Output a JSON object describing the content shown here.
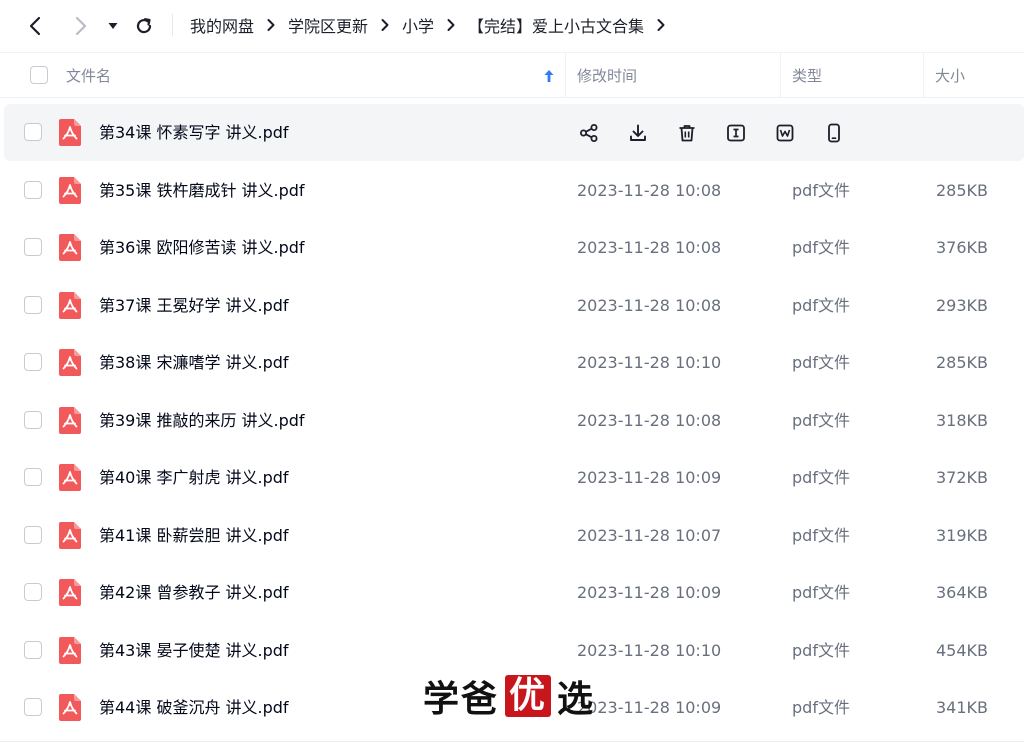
{
  "nav": {
    "back_icon": "chevron-left-icon",
    "forward_icon": "chevron-right-icon",
    "dropdown_icon": "caret-down-icon",
    "refresh_icon": "refresh-icon"
  },
  "breadcrumb": [
    {
      "label": "我的网盘"
    },
    {
      "label": "学院区更新"
    },
    {
      "label": "小学"
    },
    {
      "label": "【完结】爱上小古文合集"
    }
  ],
  "columns": {
    "name": "文件名",
    "time": "修改时间",
    "type": "类型",
    "size": "大小",
    "sort_icon": "sort-ascending-arrow-icon"
  },
  "hover_actions": [
    {
      "icon": "share-icon"
    },
    {
      "icon": "download-icon"
    },
    {
      "icon": "trash-icon"
    },
    {
      "icon": "rename-icon"
    },
    {
      "icon": "word-convert-icon"
    },
    {
      "icon": "phone-icon"
    }
  ],
  "files": [
    {
      "name": "第34课 怀素写字 讲义.pdf",
      "time": "",
      "type": "",
      "size": "",
      "hovered": true
    },
    {
      "name": "第35课 铁杵磨成针 讲义.pdf",
      "time": "2023-11-28 10:08",
      "type": "pdf文件",
      "size": "285KB"
    },
    {
      "name": "第36课 欧阳修苦读 讲义.pdf",
      "time": "2023-11-28 10:08",
      "type": "pdf文件",
      "size": "376KB"
    },
    {
      "name": "第37课 王冕好学 讲义.pdf",
      "time": "2023-11-28 10:08",
      "type": "pdf文件",
      "size": "293KB"
    },
    {
      "name": "第38课 宋濂嗜学 讲义.pdf",
      "time": "2023-11-28 10:10",
      "type": "pdf文件",
      "size": "285KB"
    },
    {
      "name": "第39课 推敲的来历 讲义.pdf",
      "time": "2023-11-28 10:08",
      "type": "pdf文件",
      "size": "318KB"
    },
    {
      "name": "第40课 李广射虎 讲义.pdf",
      "time": "2023-11-28 10:09",
      "type": "pdf文件",
      "size": "372KB"
    },
    {
      "name": "第41课 卧薪尝胆 讲义.pdf",
      "time": "2023-11-28 10:07",
      "type": "pdf文件",
      "size": "319KB"
    },
    {
      "name": "第42课 曾参教子 讲义.pdf",
      "time": "2023-11-28 10:09",
      "type": "pdf文件",
      "size": "364KB"
    },
    {
      "name": "第43课 晏子使楚 讲义.pdf",
      "time": "2023-11-28 10:10",
      "type": "pdf文件",
      "size": "454KB"
    },
    {
      "name": "第44课 破釜沉舟 讲义.pdf",
      "time": "2023-11-28 10:09",
      "type": "pdf文件",
      "size": "341KB"
    }
  ],
  "watermark": {
    "part1": "学爸",
    "part2": "优",
    "part3": "选"
  },
  "colors": {
    "pdf_icon": "#f2595b",
    "sort_arrow": "#2f7cf6",
    "hover_bg": "#f4f5f7",
    "watermark_red": "#c8161d"
  }
}
